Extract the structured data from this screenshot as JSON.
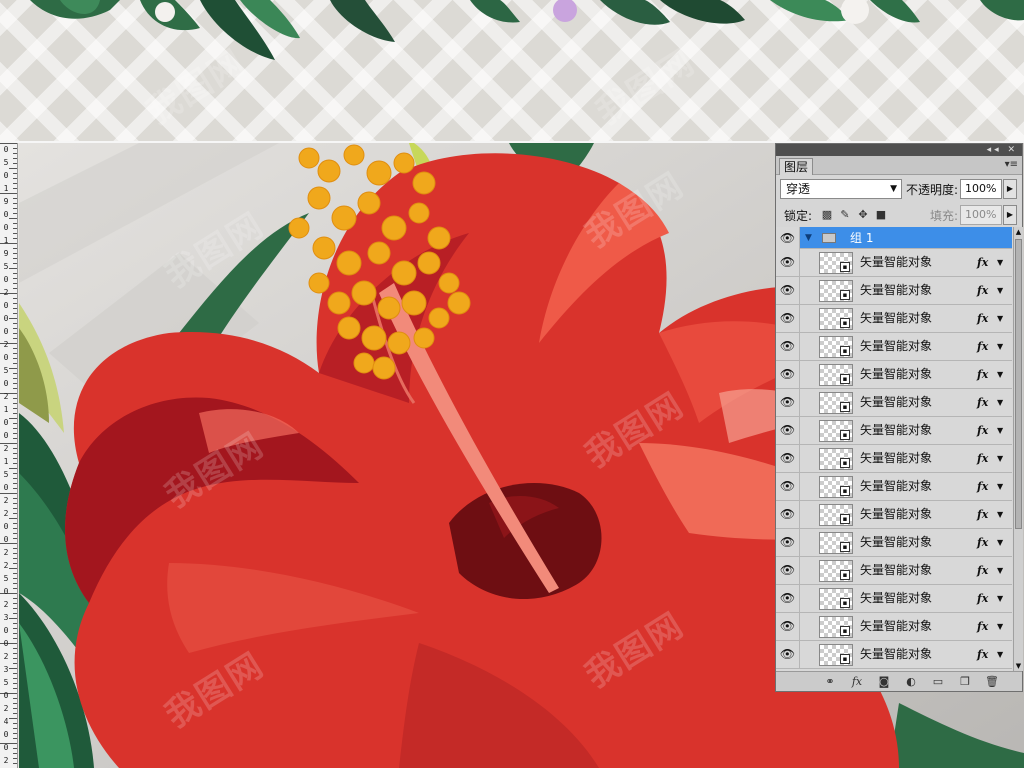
{
  "watermark": "我图网",
  "ruler": {
    "labels": [
      "0",
      "5",
      "0",
      "1",
      "9",
      "0",
      "0",
      "1",
      "9",
      "5",
      "0",
      "2",
      "0",
      "0",
      "0",
      "2",
      "0",
      "5",
      "0",
      "2",
      "1",
      "0",
      "0",
      "2",
      "1",
      "5",
      "0",
      "2",
      "2",
      "0",
      "0",
      "2",
      "2",
      "5",
      "0",
      "2",
      "3",
      "0",
      "0",
      "2",
      "3",
      "5",
      "0",
      "2",
      "4",
      "0",
      "0",
      "2"
    ]
  },
  "layers_panel": {
    "tab_label": "图层",
    "blend_mode": "穿透",
    "opacity_label": "不透明度:",
    "opacity_value": "100%",
    "lock_label": "锁定:",
    "fill_label": "填充:",
    "fill_value": "100%",
    "group": {
      "name": "组 1"
    },
    "layers": [
      {
        "name": "矢量智能对象",
        "fx": "fx"
      },
      {
        "name": "矢量智能对象",
        "fx": "fx"
      },
      {
        "name": "矢量智能对象",
        "fx": "fx"
      },
      {
        "name": "矢量智能对象",
        "fx": "fx"
      },
      {
        "name": "矢量智能对象",
        "fx": "fx"
      },
      {
        "name": "矢量智能对象",
        "fx": "fx"
      },
      {
        "name": "矢量智能对象",
        "fx": "fx"
      },
      {
        "name": "矢量智能对象",
        "fx": "fx"
      },
      {
        "name": "矢量智能对象",
        "fx": "fx"
      },
      {
        "name": "矢量智能对象",
        "fx": "fx"
      },
      {
        "name": "矢量智能对象",
        "fx": "fx"
      },
      {
        "name": "矢量智能对象",
        "fx": "fx"
      },
      {
        "name": "矢量智能对象",
        "fx": "fx"
      },
      {
        "name": "矢量智能对象",
        "fx": "fx"
      },
      {
        "name": "矢量智能对象",
        "fx": "fx"
      }
    ],
    "bottom_fx_label": "fx"
  },
  "colors": {
    "selection": "#3d8ee8",
    "petal": "#d9332c",
    "petal_dark": "#a3161e",
    "stamen": "#f0a81c",
    "leaf": "#2e6b45"
  },
  "icons": [
    "eye-icon",
    "triangle-down-icon",
    "folder-icon",
    "smart-object-icon",
    "link-icon",
    "mask-icon",
    "adjustment-icon",
    "new-group-icon",
    "new-layer-icon",
    "trash-icon",
    "lock-transparent-icon",
    "lock-brush-icon",
    "lock-move-icon",
    "lock-all-icon",
    "panel-menu-icon"
  ]
}
